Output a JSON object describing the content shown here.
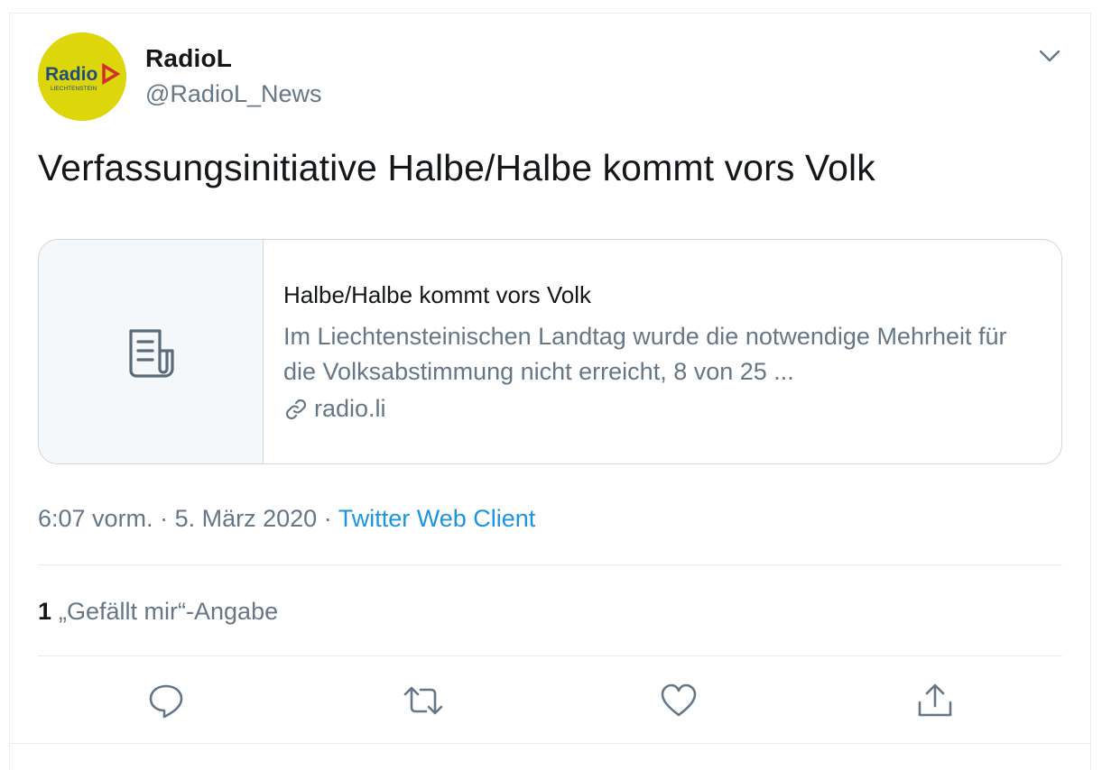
{
  "author": {
    "name": "RadioL",
    "handle": "@RadioL_News",
    "avatar_text": "Radio",
    "avatar_subtext": "LIECHTENSTEIN",
    "avatar_color": "#dcd60b"
  },
  "tweet": {
    "text": "Verfassungsinitiative Halbe/Halbe kommt vors Volk"
  },
  "card": {
    "title": "Halbe/Halbe kommt vors Volk",
    "description": "Im Liechtensteinischen Landtag wurde die notwendige Mehrheit für die Volksabstimmung nicht erreicht, 8 von 25 ...",
    "domain": "radio.li",
    "thumb_icon": "document-icon",
    "link_icon": "link-icon"
  },
  "meta": {
    "time": "6:07 vorm.",
    "separator": "·",
    "date": "5. März 2020",
    "source": "Twitter Web Client"
  },
  "stats": {
    "likes_count": "1",
    "likes_label": "„Gefällt mir“-Angabe"
  },
  "actions": {
    "reply_icon": "reply-icon",
    "retweet_icon": "retweet-icon",
    "like_icon": "heart-icon",
    "share_icon": "share-icon"
  },
  "colors": {
    "text_primary": "#14171a",
    "text_secondary": "#657786",
    "link": "#1b95e0",
    "border": "#ccd6dd",
    "divider": "#e6ecf0"
  }
}
